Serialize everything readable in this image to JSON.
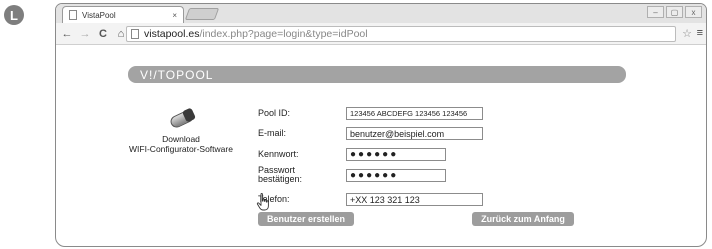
{
  "step_badge": "L",
  "browser": {
    "tab_title": "VistaPool",
    "tab_close": "×",
    "window_controls": [
      "–",
      "▢",
      "x"
    ],
    "nav": {
      "back": "←",
      "forward": "→",
      "reload": "C",
      "home": "⌂"
    },
    "url_host": "vistapool.es",
    "url_path": "/index.php?page=login&type=idPool",
    "star": "☆",
    "menu": "≡"
  },
  "page": {
    "logo_text": "V!/TOPOOL",
    "download_label_line1": "Download",
    "download_label_line2": "WIFI-Configurator-Software",
    "form": {
      "pool_id": {
        "label": "Pool ID:",
        "value": "123456 ABCDEFG 123456 123456"
      },
      "email": {
        "label": "E-mail:",
        "value": "benutzer@beispiel.com"
      },
      "password": {
        "label": "Kennwort:",
        "value": "●●●●●●"
      },
      "password_confirm": {
        "label_line1": "Passwort",
        "label_line2": "bestätigen:",
        "value": "●●●●●●"
      },
      "phone": {
        "label": "Telefon:",
        "value": "+XX 123 321 123"
      }
    },
    "buttons": {
      "create_user": "Benutzer erstellen",
      "back_to_start": "Zurück zum Anfang"
    }
  }
}
